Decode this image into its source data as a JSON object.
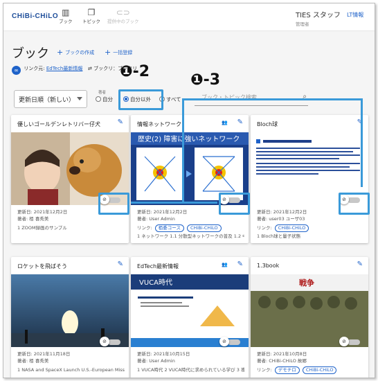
{
  "app": {
    "logo": "CHiBi-CHiLO"
  },
  "nav": [
    {
      "label": "ブック",
      "icon": "book-icon"
    },
    {
      "label": "トピック",
      "icon": "topic-icon"
    },
    {
      "label": "提供中のブック",
      "icon": "link-icon",
      "disabled": true
    }
  ],
  "user": {
    "name": "TIES スタッフ",
    "role": "管理者",
    "lt_info": "LT情報"
  },
  "page": {
    "title": "ブック",
    "create_label": "ブックの作成",
    "bulk_label": "一括登録"
  },
  "link_row": {
    "label": "リンク元:",
    "link_text": "EdTech最新情報",
    "book_label": "ブックリ：ブックリ"
  },
  "filter": {
    "sort_value": "更新日順（新しい）",
    "author_label": "著者",
    "radio_self": "自分",
    "radio_others": "自分以外",
    "radio_all": "すべて",
    "search_placeholder": "ブック・トピック検索"
  },
  "annotations": {
    "step2": "❶-2",
    "step3": "❶-3"
  },
  "cards": [
    {
      "title": "優しいゴールデンレトリバー仔犬",
      "shared": false,
      "updated": "更新日: 2021年12月2日",
      "author": "著者: 栢 喜秀美",
      "desc": "1 ZOOM録画のサンプル",
      "chips": []
    },
    {
      "title": "情報ネットワーク",
      "shared": true,
      "updated": "更新日: 2021年12月2日",
      "author": "著者: User Admin",
      "link_label": "リンク:",
      "chips": [
        "栢委コース",
        "CHiBi-CHiLO"
      ],
      "desc": "1 ネットワーク 1.1 分散型ネットワークの普及 1.2 中央集約型ネットワーク 2 ルータの役割 …",
      "thumb_text": "歴史(2) 障害に強いネットワーク"
    },
    {
      "title": "Bloch球",
      "shared": false,
      "updated": "更新日: 2021年12月2日",
      "author": "著者: user03 ユーザ03",
      "link_label": "リンク:",
      "chips": [
        "CHiBi-CHiLO"
      ],
      "desc": "1 Bloch球と量子状態"
    },
    {
      "title": "ロケットを飛ばそう",
      "shared": false,
      "updated": "更新日: 2021年11月18日",
      "author": "著者: 栢 喜秀美",
      "desc": "1 NASA and SpaceX Launch U.S.-European Mission to Monitor World's Ocean 2 …",
      "chips": []
    },
    {
      "title": "EdTech最新情報",
      "shared": true,
      "updated": "更新日: 2021年10月15日",
      "author": "著者: User Admin",
      "desc": "1 VUCA時代 2 VUCA時代に求められている学び 3 導入の事例",
      "chips": [],
      "thumb_text": "VUCA時代"
    },
    {
      "title": "1.3book",
      "shared": false,
      "updated": "更新日: 2021年10月8日",
      "author": "著者: CHiBi-CHiLO 故郷",
      "link_label": "リンク:",
      "chips": [
        "デモチロ",
        "CHiBi-CHiLO"
      ],
      "desc": "",
      "thumb_text": "戦争"
    }
  ],
  "colors": {
    "accent": "#1e62c9",
    "highlight": "#3a9ad9",
    "logo": "#1e4e9a"
  }
}
